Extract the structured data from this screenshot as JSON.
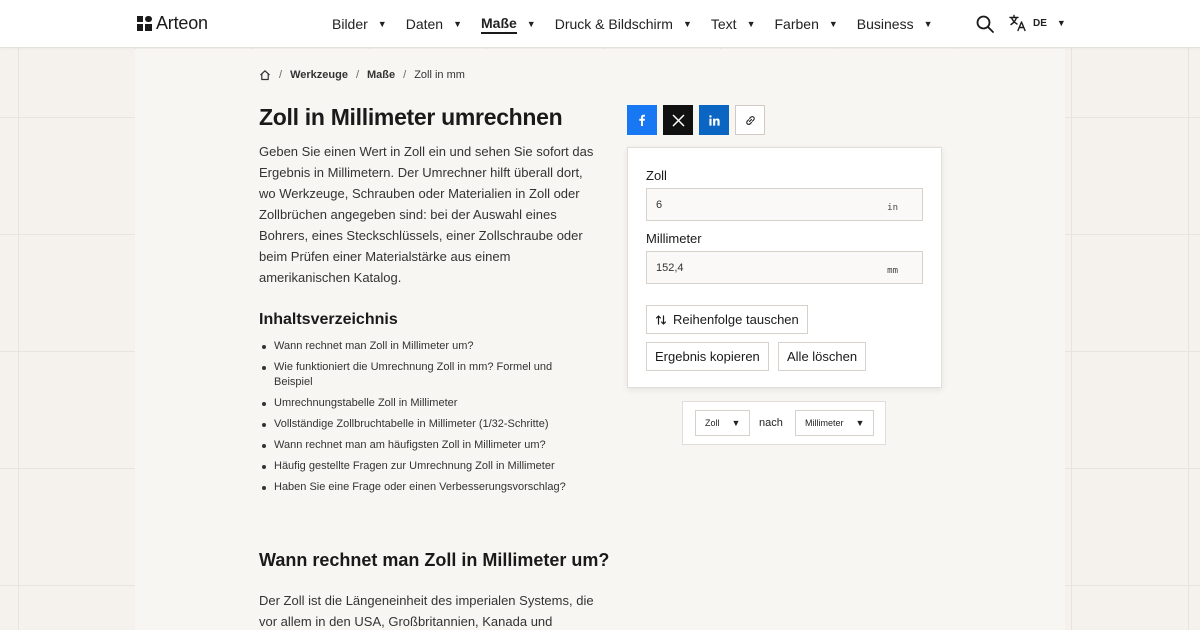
{
  "brand": {
    "name": "Arteon"
  },
  "nav": {
    "items": [
      {
        "label": "Bilder"
      },
      {
        "label": "Daten"
      },
      {
        "label": "Maße",
        "active": true
      },
      {
        "label": "Druck & Bildschirm"
      },
      {
        "label": "Text"
      },
      {
        "label": "Farben"
      },
      {
        "label": "Business"
      }
    ],
    "search_icon": "search-icon",
    "language": {
      "icon": "translate-icon",
      "code": "DE"
    }
  },
  "breadcrumb": {
    "home_icon": "home-icon",
    "items": [
      "Werkzeuge",
      "Maße",
      "Zoll in mm"
    ]
  },
  "page": {
    "title": "Zoll in Millimeter umrechnen",
    "intro": "Geben Sie einen Wert in Zoll ein und sehen Sie sofort das Ergebnis in Millimetern. Der Umrechner hilft überall dort, wo Werkzeuge, Schrauben oder Materialien in Zoll oder Zollbrüchen angegeben sind: bei der Auswahl eines Bohrers, eines Steckschlüssels, einer Zollschraube oder beim Prüfen einer Materialstärke aus einem amerikanischen Katalog.",
    "toc_title": "Inhaltsverzeichnis",
    "toc": [
      "Wann rechnet man Zoll in Millimeter um?",
      "Wie funktioniert die Umrechnung Zoll in mm? Formel und Beispiel",
      "Umrechnungstabelle Zoll in Millimeter",
      "Vollständige Zollbruchtabelle in Millimeter (1/32-Schritte)",
      "Wann rechnet man am häufigsten Zoll in Millimeter um?",
      "Häufig gestellte Fragen zur Umrechnung Zoll in Millimeter",
      "Haben Sie eine Frage oder einen Verbesserungsvorschlag?"
    ],
    "section_title": "Wann rechnet man Zoll in Millimeter um?",
    "section_text": "Der Zoll ist die Längeneinheit des imperialen Systems, die vor allem in den USA, Großbritannien, Kanada und"
  },
  "share": {
    "buttons": [
      {
        "name": "facebook",
        "icon": "facebook-icon",
        "color": "#1877f2"
      },
      {
        "name": "x",
        "icon": "x-icon",
        "color": "#111111"
      },
      {
        "name": "linkedin",
        "icon": "linkedin-icon",
        "color": "#0a66c2"
      },
      {
        "name": "copy-link",
        "icon": "link-icon",
        "color": "#ffffff"
      }
    ]
  },
  "calculator": {
    "from": {
      "label": "Zoll",
      "value": "6",
      "unit": "in"
    },
    "to": {
      "label": "Millimeter",
      "value": "152,4",
      "unit": "mm"
    },
    "swap_label": "Reihenfolge tauschen",
    "swap_icon": "swap-icon",
    "copy_label": "Ergebnis kopieren",
    "clear_label": "Alle löschen"
  },
  "converter": {
    "from_unit": "Zoll",
    "connector": "nach",
    "to_unit": "Millimeter"
  }
}
